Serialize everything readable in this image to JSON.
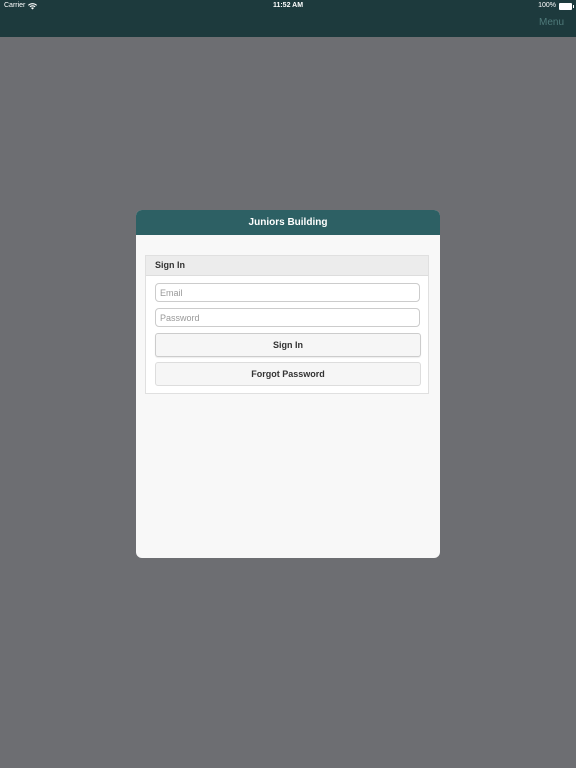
{
  "status_bar": {
    "carrier": "Carrier",
    "time": "11:52 AM",
    "battery": "100%"
  },
  "nav": {
    "menu_label": "Menu"
  },
  "modal": {
    "title": "Juniors Building",
    "panel_title": "Sign In",
    "email_placeholder": "Email",
    "password_placeholder": "Password",
    "signin_label": "Sign In",
    "forgot_label": "Forgot Password"
  },
  "colors": {
    "header_dark": "#1d3a3d",
    "modal_header": "#2d6064",
    "backdrop": "#6d6e72"
  }
}
